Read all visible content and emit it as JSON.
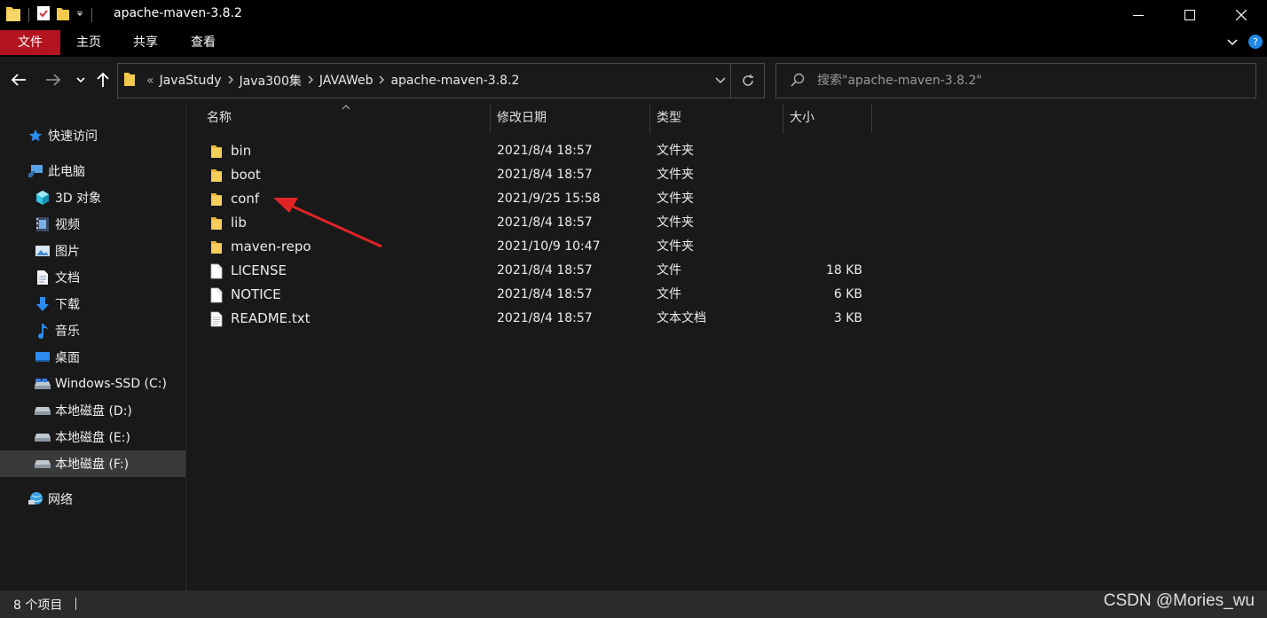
{
  "window": {
    "title": "apache-maven-3.8.2"
  },
  "ribbon": {
    "tabs": [
      {
        "label": "文件"
      },
      {
        "label": "主页"
      },
      {
        "label": "共享"
      },
      {
        "label": "查看"
      }
    ]
  },
  "address": {
    "overflow": "«",
    "crumbs": [
      "JavaStudy",
      "Java300集",
      "JAVAWeb",
      "apache-maven-3.8.2"
    ]
  },
  "search": {
    "placeholder": "搜索\"apache-maven-3.8.2\""
  },
  "sidebar": {
    "items": [
      {
        "label": "快速访问",
        "icon": "star-icon"
      },
      {
        "label": "此电脑",
        "icon": "computer-icon"
      },
      {
        "label": "3D 对象",
        "icon": "cube-icon"
      },
      {
        "label": "视频",
        "icon": "video-icon"
      },
      {
        "label": "图片",
        "icon": "picture-icon"
      },
      {
        "label": "文档",
        "icon": "document-icon"
      },
      {
        "label": "下载",
        "icon": "download-icon"
      },
      {
        "label": "音乐",
        "icon": "music-icon"
      },
      {
        "label": "桌面",
        "icon": "desktop-icon"
      },
      {
        "label": "Windows-SSD (C:)",
        "icon": "drive-icon"
      },
      {
        "label": "本地磁盘 (D:)",
        "icon": "drive-icon"
      },
      {
        "label": "本地磁盘 (E:)",
        "icon": "drive-icon"
      },
      {
        "label": "本地磁盘 (F:)",
        "icon": "drive-icon"
      },
      {
        "label": "网络",
        "icon": "network-icon"
      }
    ]
  },
  "columns": {
    "name": "名称",
    "date": "修改日期",
    "type": "类型",
    "size": "大小"
  },
  "files": [
    {
      "name": "bin",
      "date": "2021/8/4 18:57",
      "type": "文件夹",
      "size": "",
      "icon": "folder-icon"
    },
    {
      "name": "boot",
      "date": "2021/8/4 18:57",
      "type": "文件夹",
      "size": "",
      "icon": "folder-icon"
    },
    {
      "name": "conf",
      "date": "2021/9/25 15:58",
      "type": "文件夹",
      "size": "",
      "icon": "folder-icon"
    },
    {
      "name": "lib",
      "date": "2021/8/4 18:57",
      "type": "文件夹",
      "size": "",
      "icon": "folder-icon"
    },
    {
      "name": "maven-repo",
      "date": "2021/10/9 10:47",
      "type": "文件夹",
      "size": "",
      "icon": "folder-icon"
    },
    {
      "name": "LICENSE",
      "date": "2021/8/4 18:57",
      "type": "文件",
      "size": "18 KB",
      "icon": "file-icon"
    },
    {
      "name": "NOTICE",
      "date": "2021/8/4 18:57",
      "type": "文件",
      "size": "6 KB",
      "icon": "file-icon"
    },
    {
      "name": "README.txt",
      "date": "2021/8/4 18:57",
      "type": "文本文档",
      "size": "3 KB",
      "icon": "text-file-icon"
    }
  ],
  "status": {
    "count": "8 个项目"
  },
  "watermark": "CSDN @Mories_wu",
  "colors": {
    "file_tab": "#b3141f",
    "folder": "#f2c94c",
    "annotation_arrow": "#e02424",
    "selected": "#3a3a3a"
  }
}
